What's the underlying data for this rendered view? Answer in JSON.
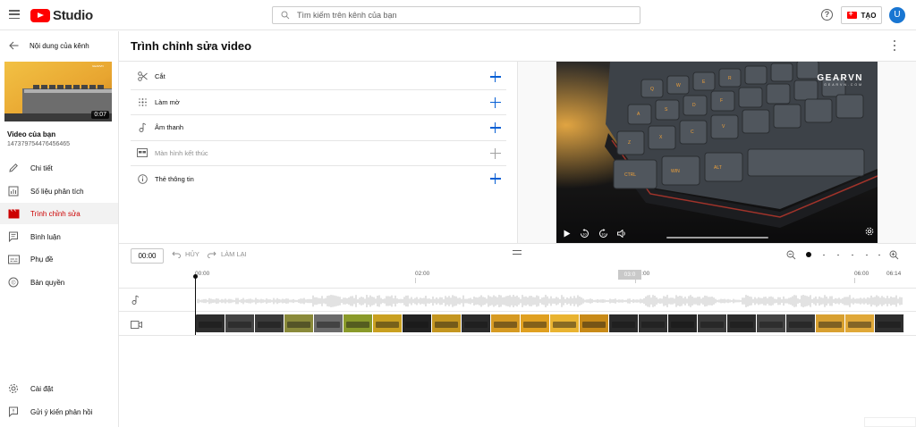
{
  "topbar": {
    "logo_text": "Studio",
    "search_placeholder": "Tìm kiếm trên kênh của bạn",
    "help_glyph": "?",
    "create_label": "TẠO",
    "avatar_letter": "U"
  },
  "sidebar": {
    "back_label": "Nội dung của kênh",
    "thumbnail_duration": "0:07",
    "video_title": "Video của bạn",
    "video_id": "147379754476456465",
    "items": [
      {
        "label": "Chi tiết",
        "icon": "pencil-icon"
      },
      {
        "label": "Số liệu phân tích",
        "icon": "analytics-icon"
      },
      {
        "label": "Trình chỉnh sửa",
        "icon": "editor-icon",
        "active": true
      },
      {
        "label": "Bình luận",
        "icon": "comments-icon"
      },
      {
        "label": "Phụ đề",
        "icon": "subtitles-icon"
      },
      {
        "label": "Bản quyền",
        "icon": "copyright-icon"
      }
    ],
    "bottom_items": [
      {
        "label": "Cài đặt",
        "icon": "gear-icon"
      },
      {
        "label": "Gửi ý kiến phản hồi",
        "icon": "feedback-icon"
      }
    ]
  },
  "editor": {
    "title": "Trình chỉnh sửa video",
    "tools": [
      {
        "label": "Cắt",
        "icon": "scissors-icon"
      },
      {
        "label": "Làm mờ",
        "icon": "blur-icon"
      },
      {
        "label": "Âm thanh",
        "icon": "music-note-icon"
      },
      {
        "label": "Màn hình kết thúc",
        "icon": "end-screen-icon",
        "disabled": true
      },
      {
        "label": "Thẻ thông tin",
        "icon": "info-icon"
      }
    ]
  },
  "player": {
    "watermark": "GEARVN",
    "watermark_sub": "GEARVN.COM"
  },
  "timeline": {
    "current_time": "00:00",
    "undo_label": "HỦY",
    "redo_label": "LÀM LẠI",
    "ruler_labels": [
      "00:00",
      "02:00",
      "04:00",
      "06:00",
      "06:14"
    ],
    "hover_time": "03:0"
  },
  "colors": {
    "accent_blue": "#065fd4",
    "brand_red": "#ff0000",
    "active_red": "#cc0000"
  }
}
